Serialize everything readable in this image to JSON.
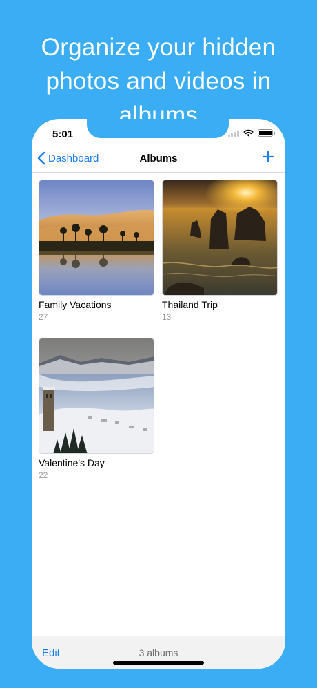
{
  "headline": {
    "line1": "Organize your hidden",
    "line2": "photos and videos in",
    "line3": "albums"
  },
  "status_bar": {
    "time": "5:01"
  },
  "navbar": {
    "back_label": "Dashboard",
    "title": "Albums",
    "add_icon": "plus-icon"
  },
  "albums": [
    {
      "name": "Family Vacations",
      "count": "27",
      "image": "desert-oasis-photo"
    },
    {
      "name": "Thailand Trip",
      "count": "13",
      "image": "sea-stacks-sunset-photo"
    },
    {
      "name": "Valentine's Day",
      "count": "22",
      "image": "snowy-lake-village-photo"
    }
  ],
  "toolbar": {
    "edit_label": "Edit",
    "summary": "3 albums"
  },
  "colors": {
    "background": "#3AADF5",
    "accent": "#1A7CF5"
  }
}
